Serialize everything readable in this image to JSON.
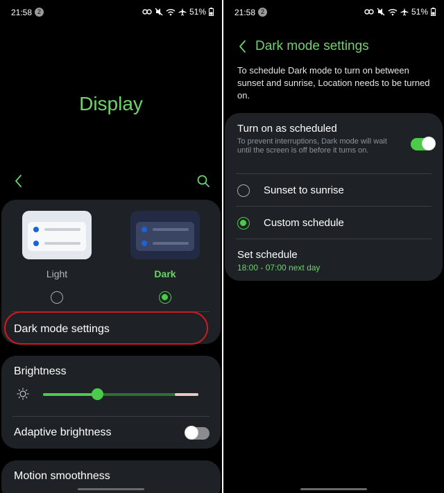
{
  "left_screen": {
    "status": {
      "time": "21:58",
      "notif_count": "2",
      "battery": "51%"
    },
    "title": "Display",
    "themes": [
      {
        "label": "Light",
        "selected": false
      },
      {
        "label": "Dark",
        "selected": true
      }
    ],
    "dark_mode_settings": "Dark mode settings",
    "brightness": {
      "label": "Brightness",
      "level": 0.35
    },
    "adaptive_brightness": {
      "label": "Adaptive brightness",
      "enabled": false
    },
    "motion_smoothness": "Motion smoothness"
  },
  "right_screen": {
    "status": {
      "time": "21:58",
      "notif_count": "2",
      "battery": "51%"
    },
    "title": "Dark mode settings",
    "description": "To schedule Dark mode to turn on between sunset and sunrise, Location needs to be turned on.",
    "scheduled": {
      "title": "Turn on as scheduled",
      "subtitle": "To prevent interruptions, Dark mode will wait until the screen is off before it turns on.",
      "enabled": true
    },
    "options": [
      {
        "label": "Sunset to sunrise",
        "selected": false
      },
      {
        "label": "Custom schedule",
        "selected": true
      }
    ],
    "set_schedule": {
      "title": "Set schedule",
      "value": "18:00 - 07:00 next day"
    }
  },
  "colors": {
    "accent": "#6fd26a",
    "accent_strong": "#4ccb4a",
    "card": "#1e2226",
    "highlight_ring": "#d0191f"
  },
  "icons": [
    "back-icon",
    "search-icon",
    "sun-icon",
    "wifi-icon",
    "airplane-icon",
    "mute-icon",
    "battery-icon",
    "link-icon"
  ]
}
